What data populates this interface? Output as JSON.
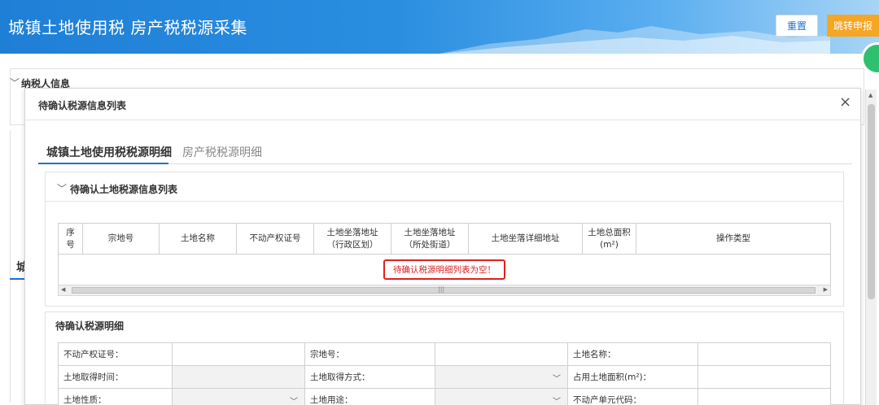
{
  "header": {
    "title": "城镇土地使用税 房产税税源采集",
    "reset_label": "重置",
    "jump_label": "跳转申报"
  },
  "background": {
    "section_title": "纳税人信息",
    "side_text": "城"
  },
  "modal": {
    "title": "待确认税源信息列表",
    "close": "×",
    "tabs": [
      {
        "label": "城镇土地使用税税源明细",
        "active": true
      },
      {
        "label": "房产税税源明细",
        "active": false
      }
    ],
    "list_panel": {
      "title": "待确认土地税源信息列表",
      "columns": [
        "序\n号",
        "宗地号",
        "土地名称",
        "不动产权证号",
        "土地坐落地址\n（行政区划）",
        "土地坐落地址\n（所处街道）",
        "土地坐落详细地址",
        "土地总面积\n(m²)",
        "操作类型"
      ],
      "empty_message": "待确认税源明细列表为空！"
    },
    "detail_panel": {
      "title": "待确认税源明细",
      "rows": [
        [
          {
            "label": "不动产权证号：",
            "type": "input"
          },
          {
            "label": "宗地号：",
            "type": "input"
          },
          {
            "label": "土地名称：",
            "type": "input"
          }
        ],
        [
          {
            "label": "土地取得时间：",
            "type": "input-gray"
          },
          {
            "label": "土地取得方式：",
            "type": "select"
          },
          {
            "label": "占用土地面积(m²)：",
            "type": "input"
          }
        ],
        [
          {
            "label": "土地性质：",
            "type": "select"
          },
          {
            "label": "土地用途：",
            "type": "select"
          },
          {
            "label": "不动产单元代码：",
            "type": "input"
          }
        ]
      ]
    }
  },
  "colors": {
    "banner": "#2a8ee0",
    "accent": "#1e72c8",
    "jump_button": "#f5a623",
    "error": "#e02020"
  }
}
